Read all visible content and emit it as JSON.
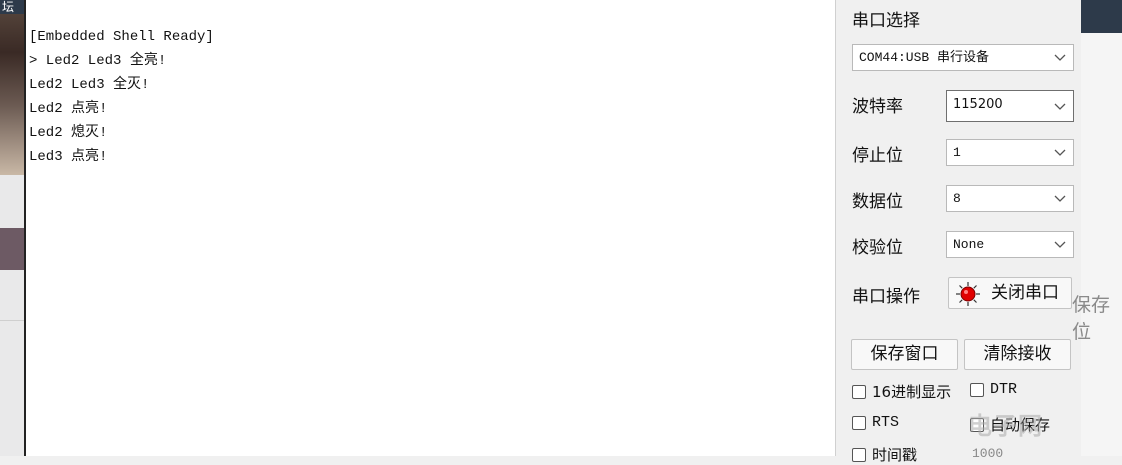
{
  "background": {
    "top_left_fragment": "坛",
    "right_fragment": "保存 位"
  },
  "terminal": {
    "lines": [
      "[Embedded Shell Ready]",
      "> Led2 Led3 全亮!",
      "Led2 Led3 全灭!",
      "Led2 点亮!",
      "Led2 熄灭!",
      "Led3 点亮!"
    ]
  },
  "panel": {
    "port_select_label": "串口选择",
    "port_value": "COM44:USB 串行设备",
    "baud_label": "波特率",
    "baud_value": "115200",
    "stop_label": "停止位",
    "stop_value": "1",
    "data_label": "数据位",
    "data_value": "8",
    "parity_label": "校验位",
    "parity_value": "None",
    "op_label": "串口操作",
    "close_port_label": "关闭串口",
    "save_window_label": "保存窗口",
    "clear_recv_label": "清除接收",
    "hex_display_label": "16进制显示",
    "dtr_label": "DTR",
    "rts_label": "RTS",
    "autosave_label": "自动保存",
    "timestamp_label": "时间戳",
    "timestamp_value": "1000"
  },
  "watermark": "电子网",
  "colors": {
    "status_led": "#e00000",
    "terminal_bg": "#ffffff",
    "panel_bg": "#f0f0f0"
  }
}
